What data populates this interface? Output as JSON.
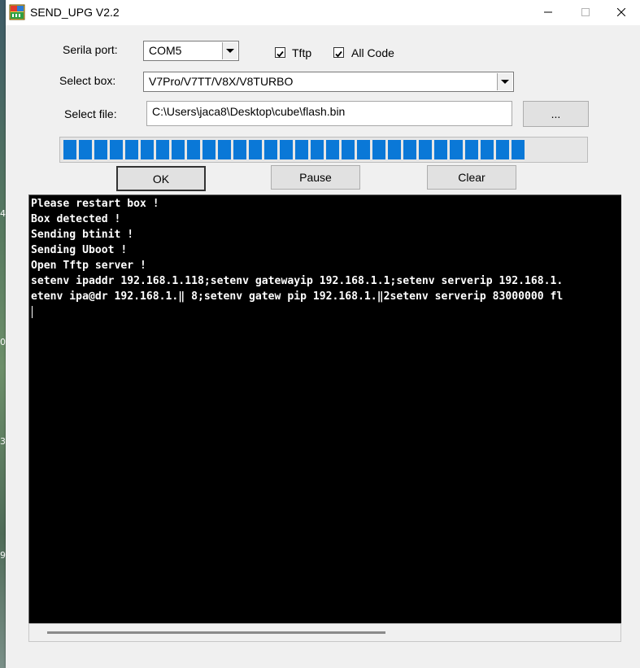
{
  "desktop": {
    "edge_numbers": [
      "4",
      "0",
      "3",
      "9"
    ]
  },
  "window": {
    "title": "SEND_UPG V2.2",
    "icon": "upg-app-icon"
  },
  "titlebar": {
    "minimize_icon": "minimize-icon",
    "maximize_icon": "maximize-icon",
    "close_icon": "close-icon"
  },
  "form": {
    "serial_port_label": "Serila port:",
    "serial_port_value": "COM5",
    "tftp_label": "Tftp",
    "tftp_checked": true,
    "all_code_label": "All Code",
    "all_code_checked": true,
    "select_box_label": "Select box:",
    "select_box_value": "V7Pro/V7TT/V8X/V8TURBO",
    "select_file_label": "Select file:",
    "select_file_value": "C:\\Users\\jaca8\\Desktop\\cube\\flash.bin",
    "browse_label": "..."
  },
  "progress": {
    "percent": 90,
    "accent_color": "#0a78d7"
  },
  "buttons": {
    "ok_label": "OK",
    "pause_label": "Pause",
    "clear_label": "Clear"
  },
  "console": {
    "lines": [
      "Please restart box !",
      "Box detected !",
      "Sending btinit !",
      "Sending Uboot !",
      "Open Tftp server !",
      "setenv ipaddr 192.168.1.118;setenv gatewayip 192.168.1.1;setenv serverip 192.168.1.",
      "etenv ipa@dr 192.168.1.‖ 8;setenv gatew pip 192.168.1.‖2setenv serverip 83000000 fl"
    ]
  }
}
